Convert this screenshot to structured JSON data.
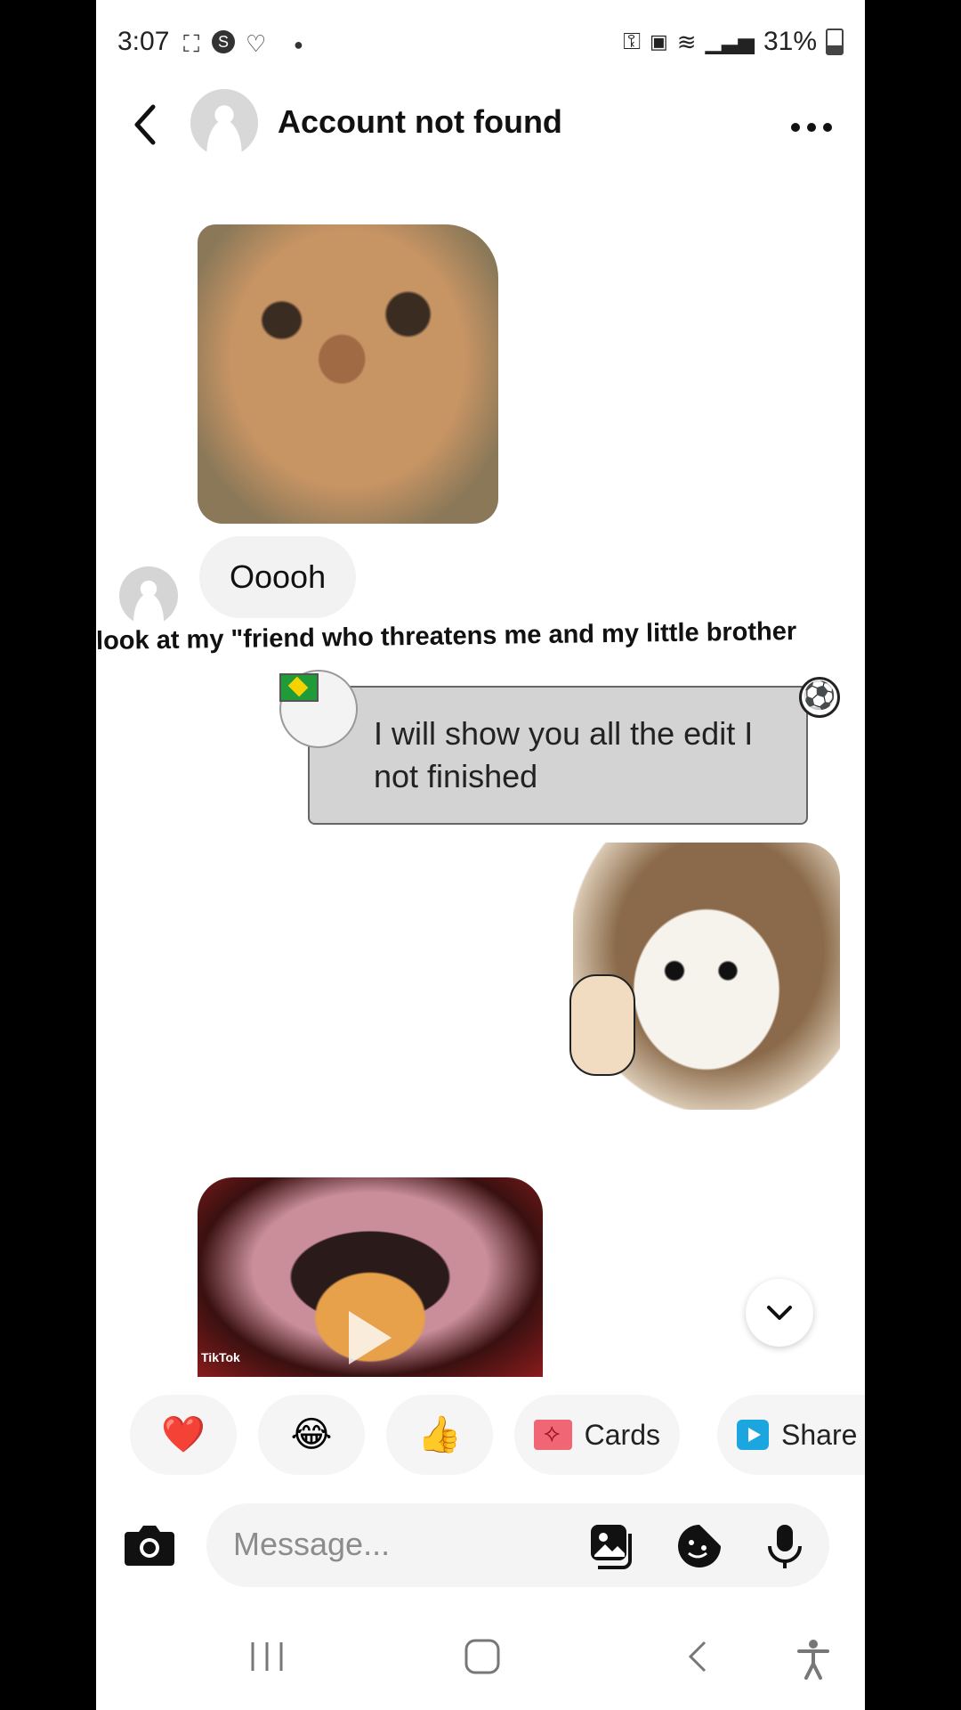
{
  "status_bar": {
    "time": "3:07",
    "icons_left": [
      "screenshot-icon",
      "s-app-icon",
      "heart-app-icon",
      "dot-icon"
    ],
    "icons_right": [
      "key-icon",
      "lock-icon",
      "wifi-icon",
      "signal-icon"
    ],
    "battery": "31%"
  },
  "header": {
    "title": "Account not found",
    "back_icon": "chevron-left-icon",
    "more_icon": "more-icon"
  },
  "messages": [
    {
      "type": "image",
      "direction": "incoming",
      "alt": "cat-sticker"
    },
    {
      "type": "text",
      "direction": "incoming",
      "text": "Ooooh"
    },
    {
      "type": "text",
      "direction": "outgoing",
      "style": "card",
      "text": "I will show you all the edit I not finished"
    },
    {
      "type": "image",
      "direction": "outgoing",
      "alt": "crying-cat-thumbs-up-sticker"
    },
    {
      "type": "video",
      "direction": "incoming",
      "badge": "TikTok"
    }
  ],
  "overlay_caption": "look at my \"friend who threatens me and my little brother",
  "quick_replies": [
    {
      "label": "❤️",
      "icon": "heart-icon"
    },
    {
      "label": "😂",
      "icon": "laugh-icon"
    },
    {
      "label": "👍",
      "icon": "thumbs-up-icon"
    },
    {
      "label": "Cards",
      "icon": "cards-icon"
    },
    {
      "label": "Share",
      "icon": "share-icon"
    }
  ],
  "composer": {
    "placeholder": "Message..."
  },
  "colors": {
    "accent_red": "#e8132a",
    "bubble_in": "#f2f2f2",
    "bubble_card": "#d3d3d3"
  }
}
